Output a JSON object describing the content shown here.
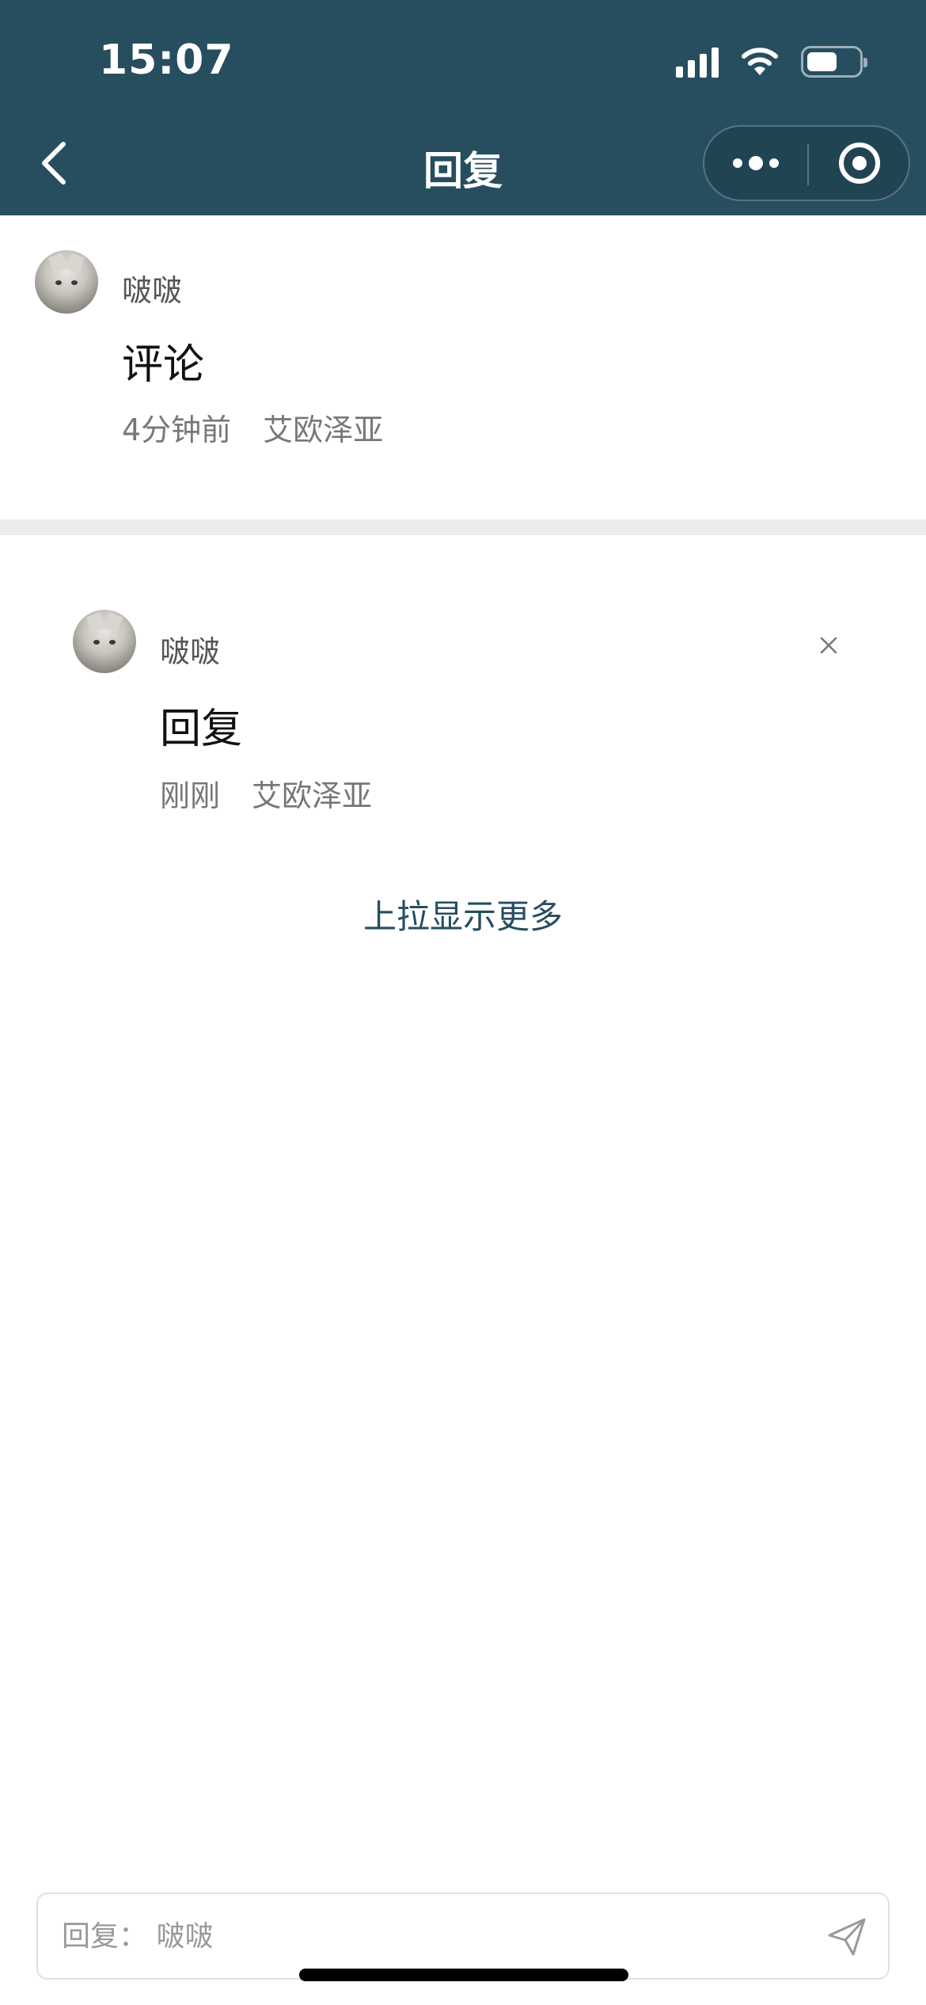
{
  "status_bar": {
    "time": "15:07"
  },
  "nav": {
    "title": "回复"
  },
  "comment": {
    "author": "啵啵",
    "text": "评论",
    "time": "4分钟前",
    "location": "艾欧泽亚"
  },
  "reply": {
    "author": "啵啵",
    "text": "回复",
    "time": "刚刚",
    "location": "艾欧泽亚"
  },
  "load_more": "上拉显示更多",
  "input": {
    "placeholder": "回复： 啵啵"
  },
  "colors": {
    "header_bg": "#264e5f",
    "accent": "#264e5f"
  }
}
